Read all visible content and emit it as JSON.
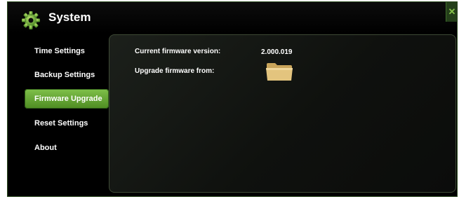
{
  "window": {
    "title": "System",
    "close_label": "✕"
  },
  "sidebar": {
    "items": [
      {
        "label": "Time Settings"
      },
      {
        "label": "Backup Settings"
      },
      {
        "label": "Firmware Upgrade",
        "active": true
      },
      {
        "label": "Reset Settings"
      },
      {
        "label": "About"
      }
    ]
  },
  "firmware": {
    "current_label": "Current firmware version:",
    "current_value": "2.000.019",
    "upgrade_label": "Upgrade firmware from:",
    "folder_icon": "folder-icon"
  },
  "colors": {
    "accent": "#6aa93a",
    "background": "#000000",
    "panel_border": "#3e4a35",
    "folder": "#e3c47e"
  }
}
